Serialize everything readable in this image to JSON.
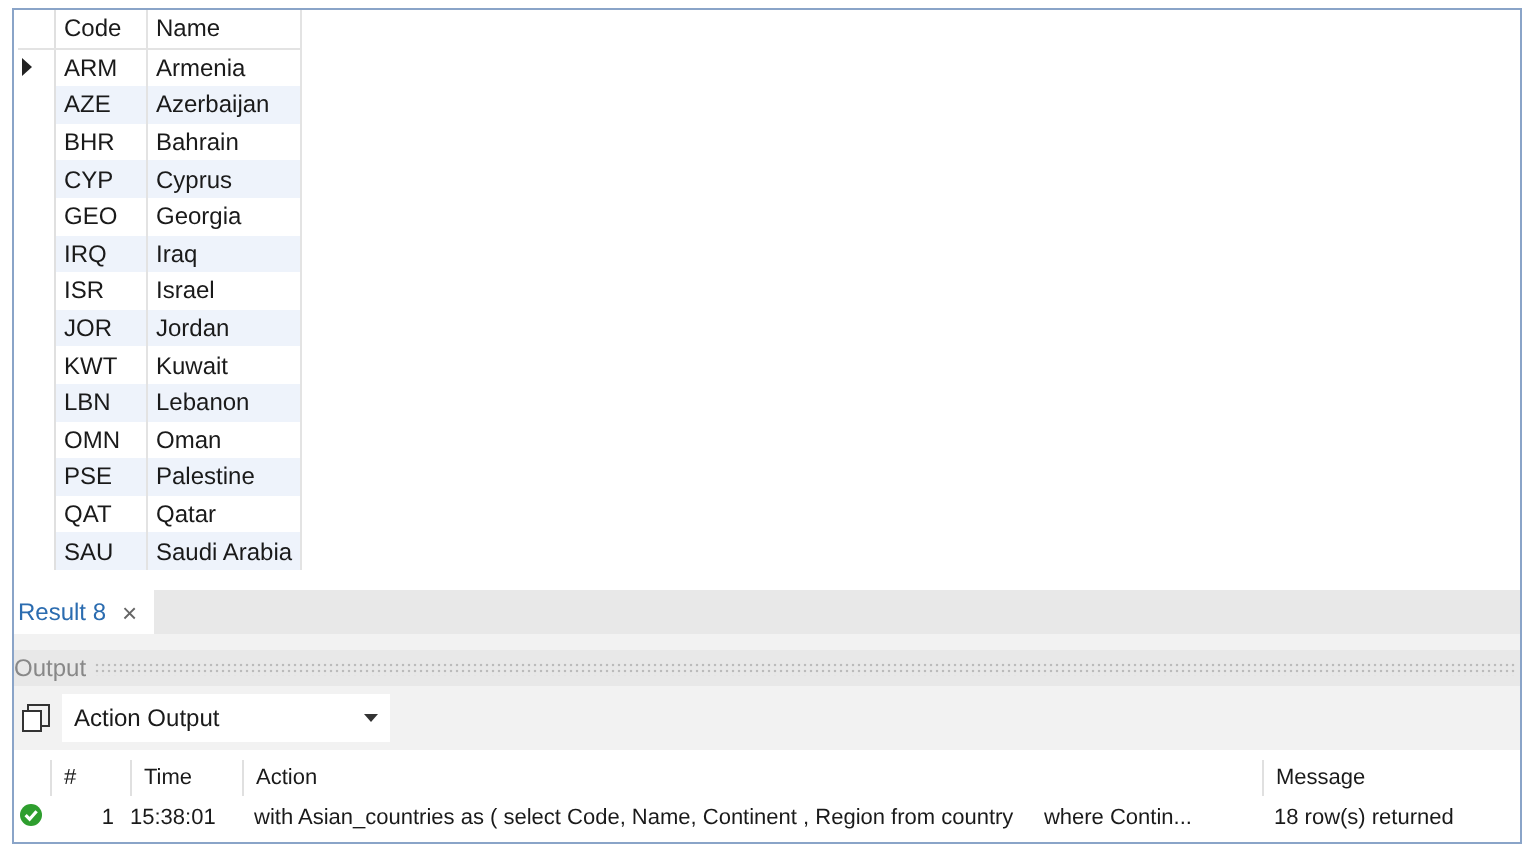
{
  "result_grid": {
    "columns": [
      "Code",
      "Name"
    ],
    "rows": [
      {
        "code": "ARM",
        "name": "Armenia",
        "current": true
      },
      {
        "code": "AZE",
        "name": "Azerbaijan",
        "current": false
      },
      {
        "code": "BHR",
        "name": "Bahrain",
        "current": false
      },
      {
        "code": "CYP",
        "name": "Cyprus",
        "current": false
      },
      {
        "code": "GEO",
        "name": "Georgia",
        "current": false
      },
      {
        "code": "IRQ",
        "name": "Iraq",
        "current": false
      },
      {
        "code": "ISR",
        "name": "Israel",
        "current": false
      },
      {
        "code": "JOR",
        "name": "Jordan",
        "current": false
      },
      {
        "code": "KWT",
        "name": "Kuwait",
        "current": false
      },
      {
        "code": "LBN",
        "name": "Lebanon",
        "current": false
      },
      {
        "code": "OMN",
        "name": "Oman",
        "current": false
      },
      {
        "code": "PSE",
        "name": "Palestine",
        "current": false
      },
      {
        "code": "QAT",
        "name": "Qatar",
        "current": false
      },
      {
        "code": "SAU",
        "name": "Saudi Arabia",
        "current": false
      }
    ]
  },
  "result_tabs": [
    {
      "label": "Result 8",
      "close": "×",
      "selected": true
    }
  ],
  "output_panel": {
    "title": "Output",
    "selector": "Action Output",
    "columns": [
      "#",
      "Time",
      "Action",
      "Message"
    ],
    "rows": [
      {
        "kind": "success",
        "number": "1",
        "time": "15:38:01",
        "action": "with Asian_countries as ( select Code, Name, Continent , Region from country     where Contin...",
        "message": "18 row(s) returned"
      }
    ]
  }
}
